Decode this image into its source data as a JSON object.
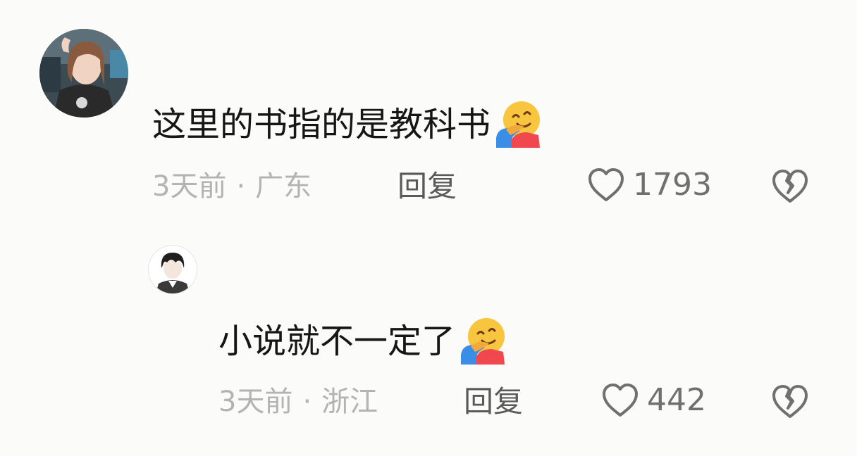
{
  "comments": [
    {
      "text": "这里的书指的是教科书",
      "emoji": "hugging-face-icon",
      "time": "3天前",
      "location": "广东",
      "separator": "·",
      "reply_label": "回复",
      "likes": "1793"
    },
    {
      "text": "小说就不一定了",
      "emoji": "hugging-face-icon",
      "time": "3天前",
      "location": "浙江",
      "separator": "·",
      "reply_label": "回复",
      "likes": "442"
    }
  ],
  "colors": {
    "background": "#fbfbf9",
    "text": "#161616",
    "meta": "#b3b3b3",
    "reply": "#5a5a5a",
    "icon": "#707070"
  }
}
